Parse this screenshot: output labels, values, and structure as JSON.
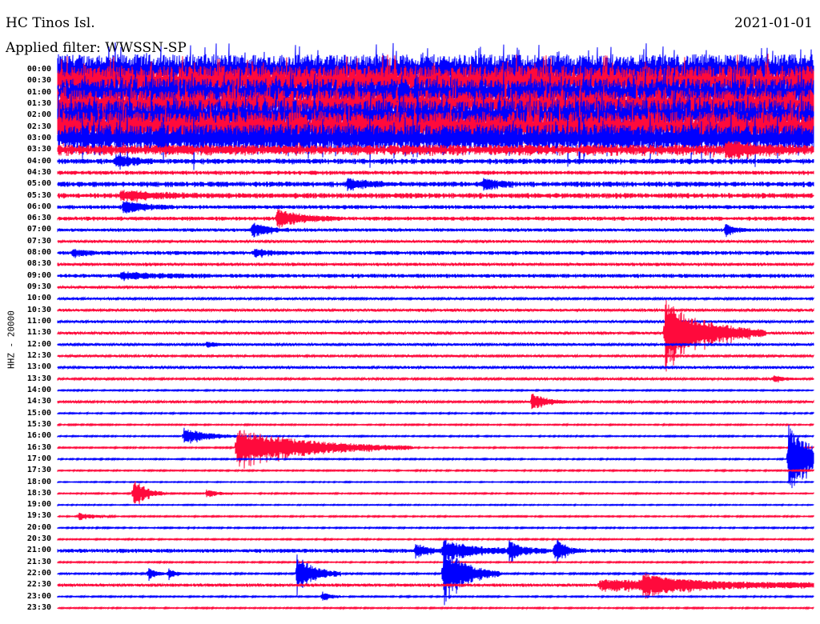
{
  "header": {
    "station": "HC Tinos Isl.",
    "filter": "Applied filter: WWSSN-SP",
    "date": "2021-01-01",
    "channel": "HHZ - 20000"
  },
  "chart_data": {
    "type": "line",
    "title": "HC Tinos Isl.",
    "subtitle": "Applied filter: WWSSN-SP",
    "ylabel": "HHZ - 20000",
    "x_range_minutes": [
      0,
      30
    ],
    "colors": {
      "even": "#0000ff",
      "odd": "#ff0a3c"
    },
    "rows": [
      "00:00",
      "00:30",
      "01:00",
      "01:30",
      "02:00",
      "02:30",
      "03:00",
      "03:30",
      "04:00",
      "04:30",
      "05:00",
      "05:30",
      "06:00",
      "06:30",
      "07:00",
      "07:30",
      "08:00",
      "08:30",
      "09:00",
      "09:30",
      "10:00",
      "10:30",
      "11:00",
      "11:30",
      "12:00",
      "12:30",
      "13:00",
      "13:30",
      "14:00",
      "14:30",
      "15:00",
      "15:30",
      "16:00",
      "16:30",
      "17:00",
      "17:30",
      "18:00",
      "18:30",
      "19:00",
      "19:30",
      "20:00",
      "20:30",
      "21:00",
      "21:30",
      "22:00",
      "22:30",
      "23:00",
      "23:30"
    ],
    "noise": [
      12,
      12,
      11,
      11,
      12,
      12,
      11,
      4,
      2,
      1.5,
      2,
      2,
      1.5,
      1.5,
      1.2,
      1,
      1.5,
      1.2,
      1.5,
      1,
      0.8,
      1,
      1,
      1,
      1,
      0.8,
      1,
      0.8,
      0.5,
      0.8,
      0.5,
      0.5,
      0.5,
      0.5,
      0.5,
      0.5,
      0.4,
      0.5,
      0.4,
      0.5,
      0.5,
      0.5,
      1.5,
      0.5,
      0.6,
      1.2,
      0.5,
      0.5
    ],
    "events": [
      {
        "row": "03:30",
        "minute": 26.5,
        "amp": 8,
        "dur": 1.2
      },
      {
        "row": "04:00",
        "minute": 2.3,
        "amp": 8,
        "dur": 0.6
      },
      {
        "row": "05:00",
        "minute": 11.5,
        "amp": 6,
        "dur": 0.8
      },
      {
        "row": "05:00",
        "minute": 16.9,
        "amp": 7,
        "dur": 0.5
      },
      {
        "row": "05:30",
        "minute": 2.5,
        "amp": 5,
        "dur": 1.5
      },
      {
        "row": "06:00",
        "minute": 2.6,
        "amp": 7,
        "dur": 0.8
      },
      {
        "row": "06:30",
        "minute": 8.7,
        "amp": 10,
        "dur": 1.0
      },
      {
        "row": "07:00",
        "minute": 7.7,
        "amp": 9,
        "dur": 0.6
      },
      {
        "row": "07:00",
        "minute": 26.5,
        "amp": 6,
        "dur": 0.4
      },
      {
        "row": "08:00",
        "minute": 0.6,
        "amp": 5,
        "dur": 0.4
      },
      {
        "row": "08:00",
        "minute": 7.8,
        "amp": 5,
        "dur": 0.5
      },
      {
        "row": "09:00",
        "minute": 2.5,
        "amp": 4,
        "dur": 1.5
      },
      {
        "row": "11:30",
        "minute": 24.1,
        "amp": 38,
        "dur": 1.6
      },
      {
        "row": "12:00",
        "minute": 5.9,
        "amp": 3,
        "dur": 0.4
      },
      {
        "row": "13:30",
        "minute": 28.4,
        "amp": 4,
        "dur": 0.4
      },
      {
        "row": "14:30",
        "minute": 18.8,
        "amp": 10,
        "dur": 0.6
      },
      {
        "row": "16:00",
        "minute": 5.0,
        "amp": 10,
        "dur": 0.9
      },
      {
        "row": "16:30",
        "minute": 7.1,
        "amp": 22,
        "dur": 2.8
      },
      {
        "row": "17:00",
        "minute": 29.0,
        "amp": 40,
        "dur": 1.0
      },
      {
        "row": "18:30",
        "minute": 3.0,
        "amp": 18,
        "dur": 0.5
      },
      {
        "row": "18:30",
        "minute": 5.9,
        "amp": 5,
        "dur": 0.4
      },
      {
        "row": "19:30",
        "minute": 0.8,
        "amp": 4,
        "dur": 0.6
      },
      {
        "row": "21:00",
        "minute": 14.2,
        "amp": 10,
        "dur": 0.4
      },
      {
        "row": "21:00",
        "minute": 15.3,
        "amp": 12,
        "dur": 1.2
      },
      {
        "row": "21:00",
        "minute": 17.9,
        "amp": 10,
        "dur": 0.6
      },
      {
        "row": "21:00",
        "minute": 19.7,
        "amp": 8,
        "dur": 0.5
      },
      {
        "row": "21:00",
        "minute": 19.8,
        "amp": 14,
        "dur": 0.2
      },
      {
        "row": "22:00",
        "minute": 3.6,
        "amp": 7,
        "dur": 0.3
      },
      {
        "row": "22:00",
        "minute": 4.4,
        "amp": 6,
        "dur": 0.3
      },
      {
        "row": "22:00",
        "minute": 9.5,
        "amp": 22,
        "dur": 0.7
      },
      {
        "row": "22:00",
        "minute": 15.3,
        "amp": 32,
        "dur": 0.9
      },
      {
        "row": "22:30",
        "minute": 21.5,
        "amp": 6,
        "dur": 7.5
      },
      {
        "row": "22:30",
        "minute": 23.2,
        "amp": 10,
        "dur": 1.2
      },
      {
        "row": "23:00",
        "minute": 10.5,
        "amp": 6,
        "dur": 0.3
      }
    ]
  }
}
